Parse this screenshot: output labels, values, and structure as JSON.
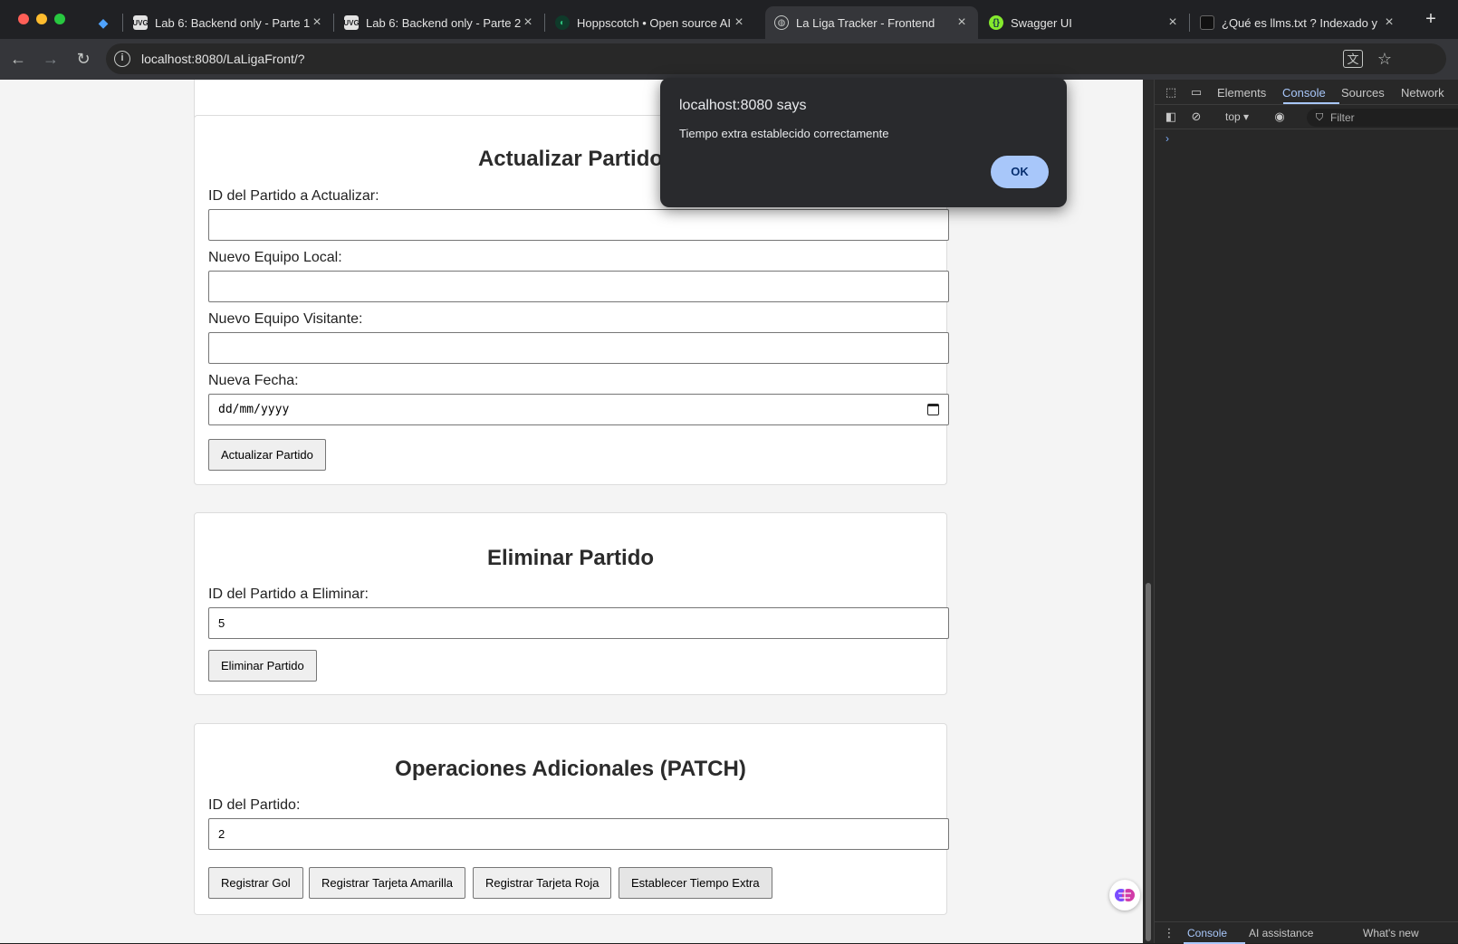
{
  "browser": {
    "tabs": [
      {
        "title": "",
        "favicon": "gem-icon"
      },
      {
        "title": "Lab 6: Backend only - Parte 1",
        "favicon": "uvg-icon"
      },
      {
        "title": "Lab 6: Backend only - Parte 2",
        "favicon": "uvg-icon"
      },
      {
        "title": "Hoppscotch • Open source AI",
        "favicon": "hoppscotch-icon"
      },
      {
        "title": "La Liga Tracker - Frontend",
        "favicon": "globe-icon",
        "active": true
      },
      {
        "title": "Swagger UI",
        "favicon": "swagger-icon"
      },
      {
        "title": "¿Qué es llms.txt ? Indexado y",
        "favicon": "site-icon"
      }
    ],
    "url": "localhost:8080/LaLigaFront/?",
    "colors": {
      "tab_strip": "#202124",
      "toolbar": "#35363a",
      "accent": "#a8c7fa"
    }
  },
  "page": {
    "update": {
      "title": "Actualizar Partido",
      "id_label": "ID del Partido a Actualizar:",
      "id_value": "",
      "home_label": "Nuevo Equipo Local:",
      "home_value": "",
      "away_label": "Nuevo Equipo Visitante:",
      "away_value": "",
      "date_label": "Nueva Fecha:",
      "date_placeholder": "dd/mm/yyyy",
      "button": "Actualizar Partido"
    },
    "delete": {
      "title": "Eliminar Partido",
      "id_label": "ID del Partido a Eliminar:",
      "id_value": "5",
      "button": "Eliminar Partido"
    },
    "patch": {
      "title": "Operaciones Adicionales (PATCH)",
      "id_label": "ID del Partido:",
      "id_value": "2",
      "buttons": [
        "Registrar Gol",
        "Registrar Tarjeta Amarilla",
        "Registrar Tarjeta Roja",
        "Establecer Tiempo Extra"
      ]
    }
  },
  "alert": {
    "title": "localhost:8080 says",
    "message": "Tiempo extra establecido correctamente",
    "ok": "OK"
  },
  "devtools": {
    "tabs": [
      "Elements",
      "Console",
      "Sources",
      "Network"
    ],
    "active_tab": "Console",
    "context": "top",
    "filter_placeholder": "Filter",
    "prompt": "›",
    "drawer_tabs": [
      "Console",
      "AI assistance",
      "What's new"
    ],
    "drawer_active": "Console"
  }
}
